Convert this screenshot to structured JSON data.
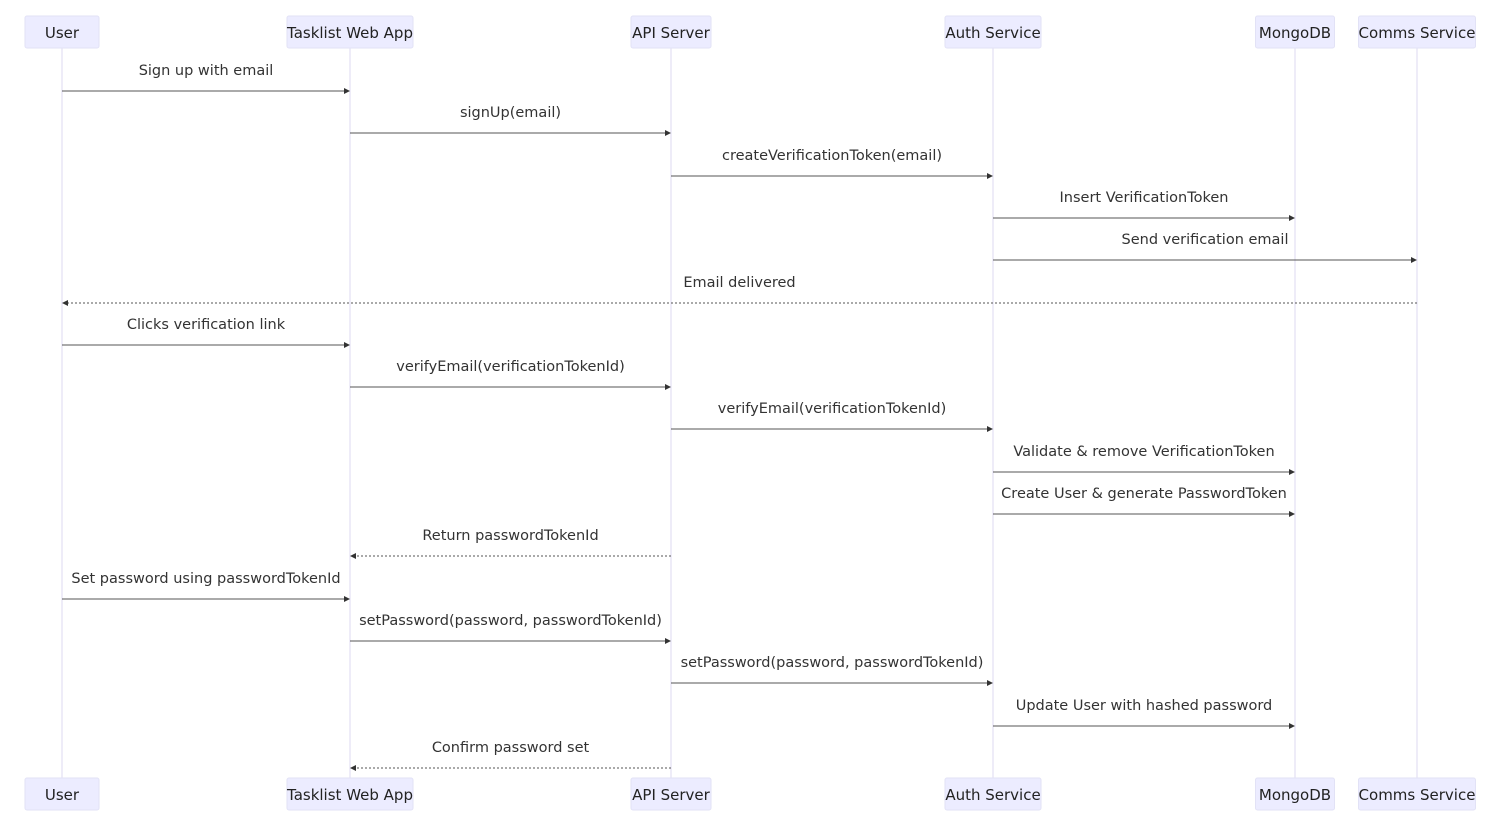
{
  "diagram": {
    "type": "sequence",
    "participants": [
      {
        "id": "user",
        "label": "User"
      },
      {
        "id": "webapp",
        "label": "Tasklist Web App"
      },
      {
        "id": "api",
        "label": "API Server"
      },
      {
        "id": "auth",
        "label": "Auth Service"
      },
      {
        "id": "mongo",
        "label": "MongoDB"
      },
      {
        "id": "comms",
        "label": "Comms Service"
      }
    ],
    "messages": [
      {
        "from": "user",
        "to": "webapp",
        "label": "Sign up with email",
        "style": "solid"
      },
      {
        "from": "webapp",
        "to": "api",
        "label": "signUp(email)",
        "style": "solid"
      },
      {
        "from": "api",
        "to": "auth",
        "label": "createVerificationToken(email)",
        "style": "solid"
      },
      {
        "from": "auth",
        "to": "mongo",
        "label": "Insert VerificationToken",
        "style": "solid"
      },
      {
        "from": "auth",
        "to": "comms",
        "label": "Send verification email",
        "style": "solid"
      },
      {
        "from": "comms",
        "to": "user",
        "label": "Email delivered",
        "style": "dotted"
      },
      {
        "from": "user",
        "to": "webapp",
        "label": "Clicks verification link",
        "style": "solid"
      },
      {
        "from": "webapp",
        "to": "api",
        "label": "verifyEmail(verificationTokenId)",
        "style": "solid"
      },
      {
        "from": "api",
        "to": "auth",
        "label": "verifyEmail(verificationTokenId)",
        "style": "solid"
      },
      {
        "from": "auth",
        "to": "mongo",
        "label": "Validate & remove VerificationToken",
        "style": "solid"
      },
      {
        "from": "auth",
        "to": "mongo",
        "label": "Create User & generate PasswordToken",
        "style": "solid"
      },
      {
        "from": "api",
        "to": "webapp",
        "label": "Return passwordTokenId",
        "style": "dotted"
      },
      {
        "from": "user",
        "to": "webapp",
        "label": "Set password using passwordTokenId",
        "style": "solid"
      },
      {
        "from": "webapp",
        "to": "api",
        "label": "setPassword(password, passwordTokenId)",
        "style": "solid"
      },
      {
        "from": "api",
        "to": "auth",
        "label": "setPassword(password, passwordTokenId)",
        "style": "solid"
      },
      {
        "from": "auth",
        "to": "mongo",
        "label": "Update User with hashed password",
        "style": "solid"
      },
      {
        "from": "api",
        "to": "webapp",
        "label": "Confirm password set",
        "style": "dotted"
      }
    ]
  }
}
